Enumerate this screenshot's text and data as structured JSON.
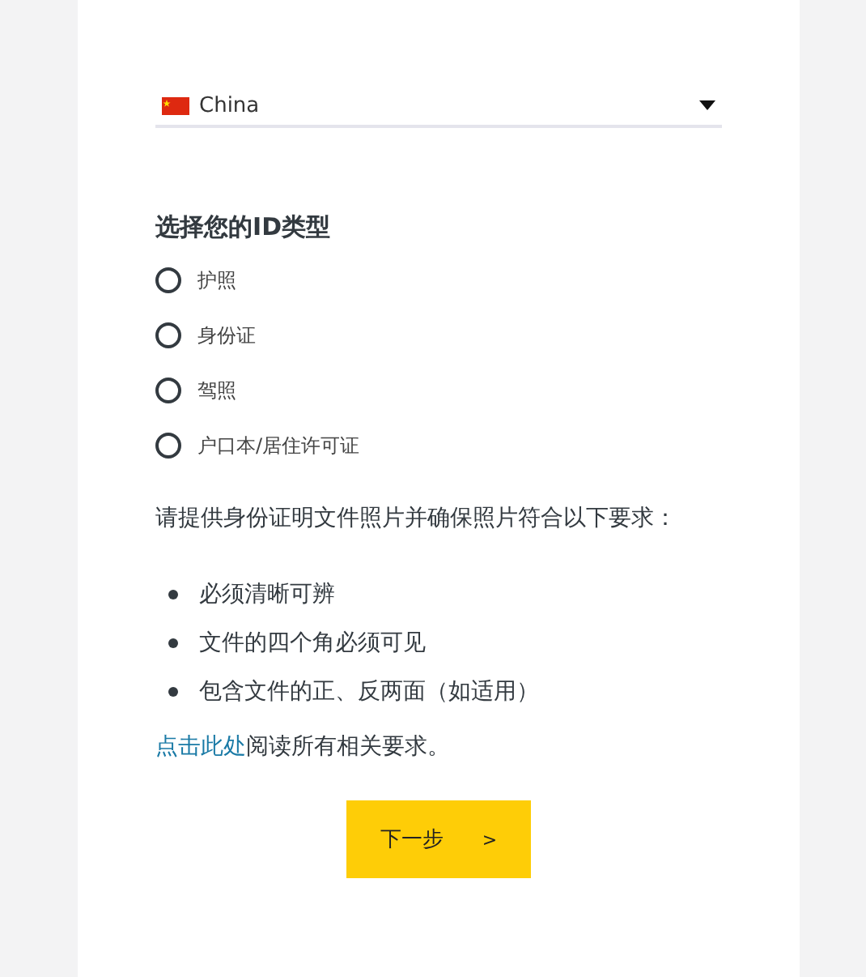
{
  "country_select": {
    "value": "China"
  },
  "id_type": {
    "title": "选择您的ID类型",
    "options": [
      {
        "label": "护照",
        "selected": false
      },
      {
        "label": "身份证",
        "selected": false
      },
      {
        "label": "驾照",
        "selected": false
      },
      {
        "label": "户口本/居住许可证",
        "selected": false
      }
    ]
  },
  "instructions": "请提供身份证明文件照片并确保照片符合以下要求：",
  "requirements": [
    "必须清晰可辨",
    "文件的四个角必须可见",
    "包含文件的正、反两面（如适用）"
  ],
  "more_info": {
    "link": "点击此处",
    "text": "阅读所有相关要求。"
  },
  "next_button": {
    "label": "下一步",
    "arrow": ">"
  }
}
